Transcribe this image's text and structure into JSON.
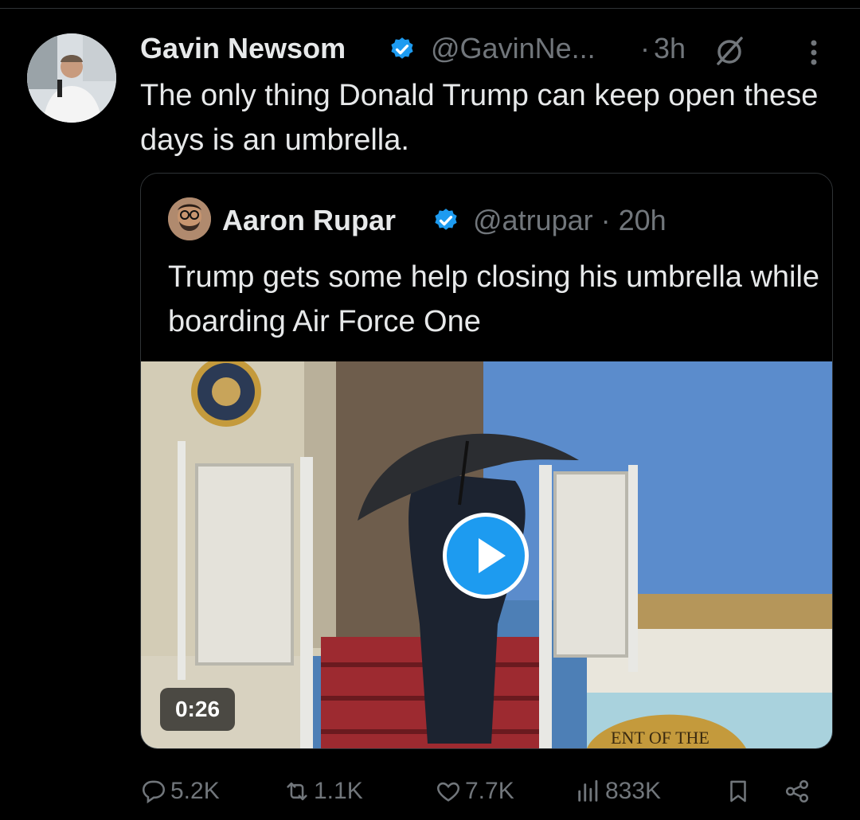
{
  "tweet": {
    "author_name": "Gavin Newsom",
    "handle": "@GavinNe...",
    "separator": "·",
    "time": "3h",
    "text": "The only thing Donald Trump can keep open these days is an umbrella."
  },
  "quoted": {
    "author_name": "Aaron Rupar",
    "handle_time": "@atrupar · 20h",
    "text": "Trump gets some help closing his umbrella while boarding Air Force One",
    "video_duration": "0:26",
    "seal_text": "ENT OF THE"
  },
  "actions": {
    "replies": "5.2K",
    "reposts": "1.1K",
    "likes": "7.7K",
    "views": "833K"
  },
  "icons": [
    "verified-badge-icon",
    "grok-icon",
    "more-icon",
    "reply-icon",
    "repost-icon",
    "like-icon",
    "views-icon",
    "bookmark-icon",
    "share-icon",
    "play-icon"
  ],
  "colors": {
    "background": "#000000",
    "text": "#e7e9ea",
    "secondary": "#71767b",
    "accent": "#1d9bf0",
    "border": "#2f3336"
  }
}
